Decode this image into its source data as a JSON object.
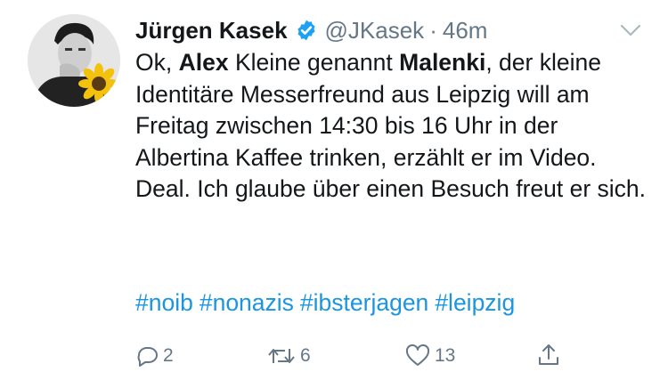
{
  "tweet": {
    "author_name": "Jürgen Kasek",
    "handle": "@JKasek",
    "separator": "·",
    "time": "46m",
    "text_parts": [
      "Ok, ",
      "Alex",
      " Kleine genannt ",
      "Malenki",
      ", der kleine Identitäre Messerfreund aus Leipzig will am Freitag zwischen 14:30 bis 16 Uhr in der Albertina Kaffee trinken, erzählt er im Video. Deal. Ich glaube über einen Besuch freut er sich."
    ],
    "hashtags": [
      "#noib",
      "#nonazis",
      "#ibsterjagen",
      "#leipzig"
    ]
  },
  "actions": {
    "replies": "2",
    "retweets": "6",
    "likes": "13"
  },
  "icons": {
    "verified": "verified-badge-icon",
    "more": "chevron-down-icon",
    "reply": "reply-icon",
    "retweet": "retweet-icon",
    "like": "heart-icon",
    "share": "share-icon"
  },
  "colors": {
    "link": "#1b95e0",
    "secondary_text": "#657786",
    "verified": "#1da1f2",
    "text": "#14171a"
  }
}
